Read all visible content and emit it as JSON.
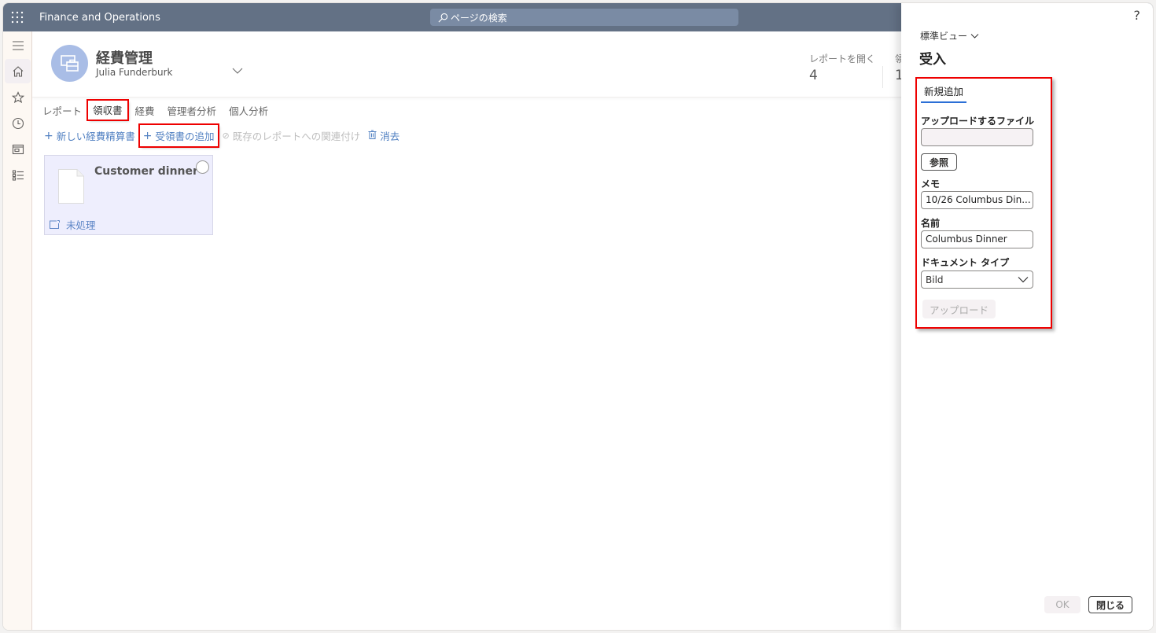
{
  "topbar": {
    "app_title": "Finance and Operations",
    "search_placeholder": "ページの検索",
    "icons": {
      "waffle": "waffle-icon",
      "search": "search-icon"
    }
  },
  "navrail": {
    "items": [
      {
        "name": "menu",
        "icon": "hamburger-icon",
        "active": false
      },
      {
        "name": "home",
        "icon": "home-icon",
        "active": true
      },
      {
        "name": "favorites",
        "icon": "star-icon",
        "active": false
      },
      {
        "name": "recent",
        "icon": "clock-icon",
        "active": false
      },
      {
        "name": "workspaces",
        "icon": "workspace-icon",
        "active": false
      },
      {
        "name": "modules",
        "icon": "list-icon",
        "active": false
      }
    ]
  },
  "workspace": {
    "title": "経費管理",
    "user": "Julia Funderburk",
    "tiles": [
      {
        "label": "レポートを開く",
        "value": "4"
      },
      {
        "label": "領",
        "value": "1"
      }
    ]
  },
  "tabs": [
    {
      "label": "レポート",
      "selected": false
    },
    {
      "label": "領収書",
      "selected": true
    },
    {
      "label": "経費",
      "selected": false
    },
    {
      "label": "管理者分析",
      "selected": false
    },
    {
      "label": "個人分析",
      "selected": false
    }
  ],
  "actions": [
    {
      "label": "新しい経費精算書",
      "icon": "+",
      "disabled": false
    },
    {
      "label": "受領書の追加",
      "icon": "+",
      "disabled": false
    },
    {
      "label": "既存のレポートへの関連付け",
      "icon": "⊘",
      "disabled": true
    },
    {
      "label": "消去",
      "icon": "🗑",
      "disabled": false
    }
  ],
  "receipt_card": {
    "title": "Customer dinner",
    "status": "未処理"
  },
  "panel": {
    "help": "?",
    "view_selector": "標準ビュー",
    "title": "受入",
    "form_tab": "新規追加",
    "file_label": "アップロードするファイル",
    "file_value": "",
    "browse_button": "参照",
    "memo_label": "メモ",
    "memo_value": "10/26 Columbus Din...",
    "name_label": "名前",
    "name_value": "Columbus Dinner",
    "doctype_label": "ドキュメント タイプ",
    "doctype_value": "Bild",
    "upload_button": "アップロード",
    "ok_button": "OK",
    "close_button": "閉じる"
  },
  "colors": {
    "topbar": "#637185",
    "accent_link": "#4f7fc1",
    "highlight": "#ee0000",
    "card_bg": "#eeeefd",
    "tab_underline": "#2b6fd6"
  }
}
